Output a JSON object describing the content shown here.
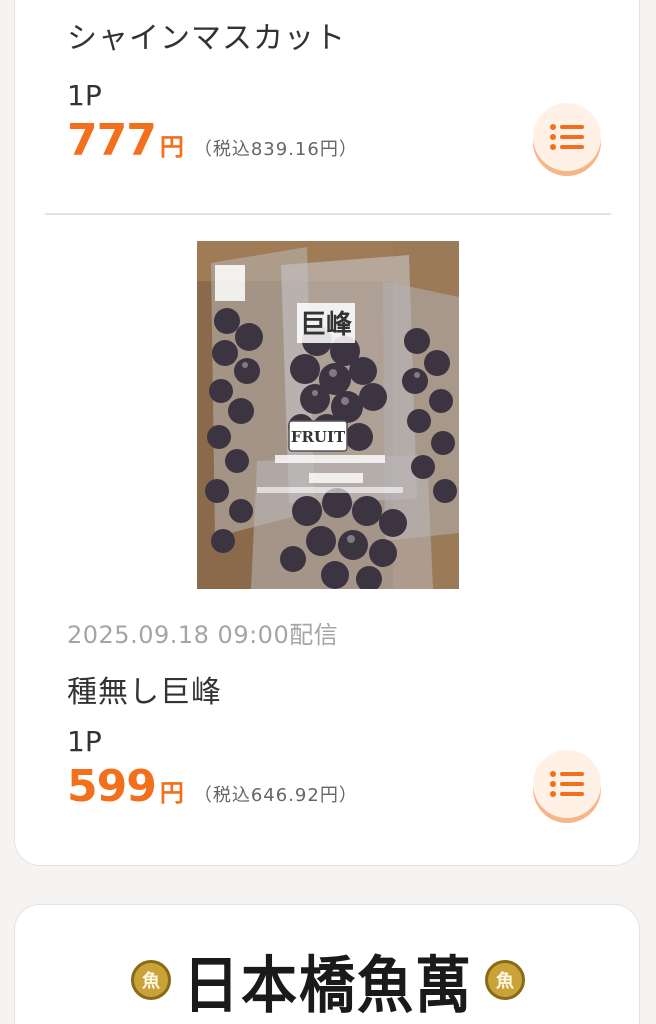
{
  "products": [
    {
      "name": "シャインマスカット",
      "quantity": "1P",
      "price": "777",
      "price_unit": "円",
      "tax_included": "（税込839.16円）",
      "list_icon": "list-icon"
    },
    {
      "delivery_date": "2025.09.18 09:00配信",
      "name": "種無し巨峰",
      "quantity": "1P",
      "price": "599",
      "price_unit": "円",
      "tax_included": "（税込646.92円）",
      "list_icon": "list-icon",
      "image_label": "FRUIT"
    }
  ],
  "store": {
    "logo_text": "日本橋魚萬",
    "emblem_glyph": "魚"
  },
  "colors": {
    "accent": "#f36f1c",
    "button_bg": "#fff1e6",
    "button_shadow": "#f7b58a",
    "muted_text": "#a5a5a5"
  }
}
